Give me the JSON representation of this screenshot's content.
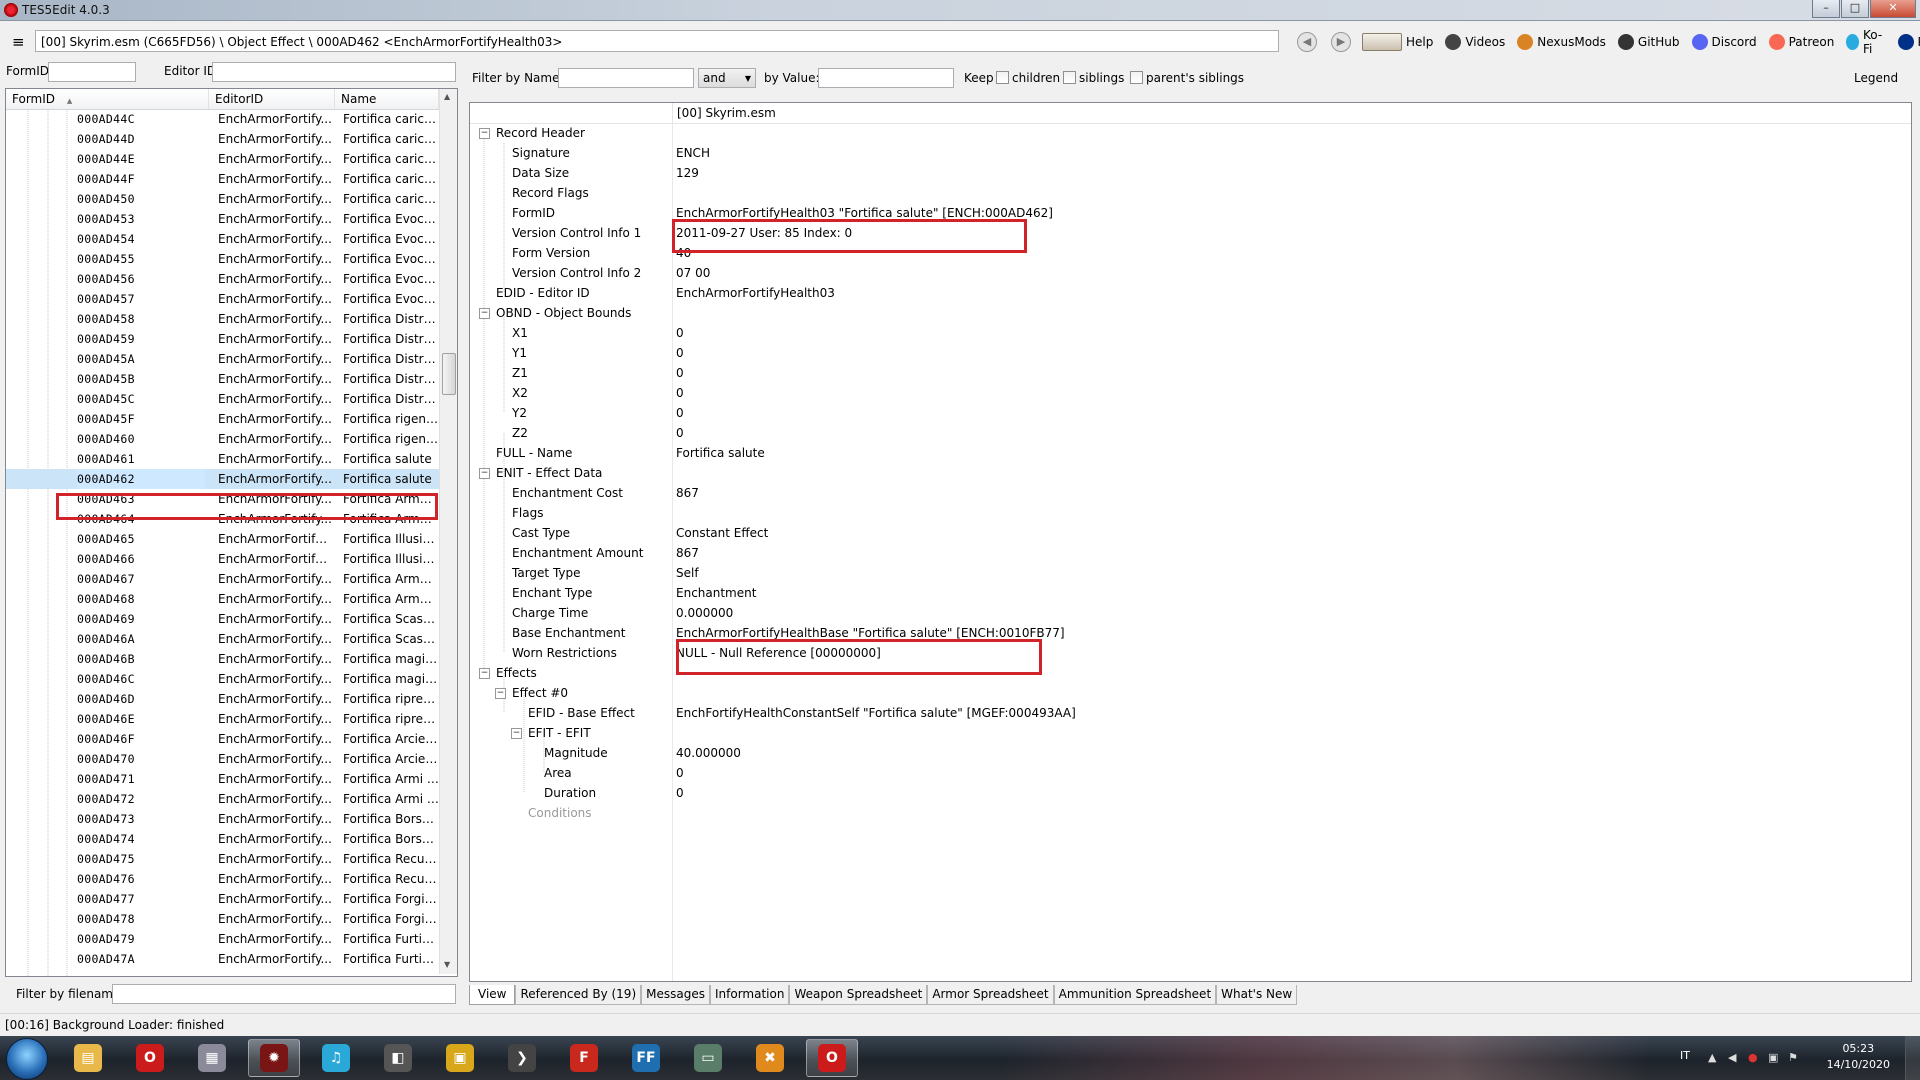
{
  "window": {
    "title": "TES5Edit 4.0.3",
    "min_label": "–",
    "max_label": "□",
    "close_label": "✕"
  },
  "pathbar": {
    "menu_glyph": "≡",
    "path": "[00] Skyrim.esm (C665FD56) \\ Object Effect \\ 000AD462 <EnchArmorFortifyHealth03>",
    "back_glyph": "◀",
    "forward_glyph": "▶",
    "links": [
      {
        "label": "Help",
        "icon": "help-book-icon",
        "color": "#8a7e68"
      },
      {
        "label": "Videos",
        "icon": "videos-icon",
        "color": "#444444"
      },
      {
        "label": "NexusMods",
        "icon": "nexusmods-icon",
        "color": "#d98324"
      },
      {
        "label": "GitHub",
        "icon": "github-icon",
        "color": "#333333"
      },
      {
        "label": "Discord",
        "icon": "discord-icon",
        "color": "#5865f2"
      },
      {
        "label": "Patreon",
        "icon": "patreon-icon",
        "color": "#f96854"
      },
      {
        "label": "Ko-Fi",
        "icon": "kofi-icon",
        "color": "#29abe0"
      },
      {
        "label": "PayPal",
        "icon": "paypal-icon",
        "color": "#003087"
      }
    ]
  },
  "left": {
    "formid_label": "FormID",
    "editorid_label": "Editor ID",
    "columns": [
      "FormID",
      "EditorID",
      "Name"
    ],
    "sort_glyph": "▲",
    "rows": [
      [
        "000AD44C",
        "EnchArmorFortify...",
        "Fortifica carico ..."
      ],
      [
        "000AD44D",
        "EnchArmorFortify...",
        "Fortifica carico ..."
      ],
      [
        "000AD44E",
        "EnchArmorFortify...",
        "Fortifica carico ..."
      ],
      [
        "000AD44F",
        "EnchArmorFortify...",
        "Fortifica carico ..."
      ],
      [
        "000AD450",
        "EnchArmorFortify...",
        "Fortifica carico ..."
      ],
      [
        "000AD453",
        "EnchArmorFortify...",
        "Fortifica Evocaz..."
      ],
      [
        "000AD454",
        "EnchArmorFortify...",
        "Fortifica Evocaz..."
      ],
      [
        "000AD455",
        "EnchArmorFortify...",
        "Fortifica Evocaz..."
      ],
      [
        "000AD456",
        "EnchArmorFortify...",
        "Fortifica Evocaz..."
      ],
      [
        "000AD457",
        "EnchArmorFortify...",
        "Fortifica Evocaz..."
      ],
      [
        "000AD458",
        "EnchArmorFortify...",
        "Fortifica Distruz..."
      ],
      [
        "000AD459",
        "EnchArmorFortify...",
        "Fortifica Distruz..."
      ],
      [
        "000AD45A",
        "EnchArmorFortify...",
        "Fortifica Distruz..."
      ],
      [
        "000AD45B",
        "EnchArmorFortify...",
        "Fortifica Distruz..."
      ],
      [
        "000AD45C",
        "EnchArmorFortify...",
        "Fortifica Distruz..."
      ],
      [
        "000AD45F",
        "EnchArmorFortify...",
        "Fortifica rigener..."
      ],
      [
        "000AD460",
        "EnchArmorFortify...",
        "Fortifica rigener..."
      ],
      [
        "000AD461",
        "EnchArmorFortify...",
        "Fortifica salute"
      ],
      [
        "000AD462",
        "EnchArmorFortify...",
        "Fortifica salute"
      ],
      [
        "000AD463",
        "EnchArmorFortify...",
        "Fortifica Armat..."
      ],
      [
        "000AD464",
        "EnchArmorFortify...",
        "Fortifica Armat..."
      ],
      [
        "000AD465",
        "EnchArmorFortifyI...",
        "Fortifica Illusione"
      ],
      [
        "000AD466",
        "EnchArmorFortifyI...",
        "Fortifica Illusione"
      ],
      [
        "000AD467",
        "EnchArmorFortify...",
        "Fortifica Armat..."
      ],
      [
        "000AD468",
        "EnchArmorFortify...",
        "Fortifica Armat..."
      ],
      [
        "000AD469",
        "EnchArmorFortify...",
        "Fortifica Scassi..."
      ],
      [
        "000AD46A",
        "EnchArmorFortify...",
        "Fortifica Scassi..."
      ],
      [
        "000AD46B",
        "EnchArmorFortify...",
        "Fortifica magicka"
      ],
      [
        "000AD46C",
        "EnchArmorFortify...",
        "Fortifica magicka"
      ],
      [
        "000AD46D",
        "EnchArmorFortify...",
        "Fortifica ripresa..."
      ],
      [
        "000AD46E",
        "EnchArmorFortify...",
        "Fortifica ripresa..."
      ],
      [
        "000AD46F",
        "EnchArmorFortify...",
        "Fortifica Arcieria"
      ],
      [
        "000AD470",
        "EnchArmorFortify...",
        "Fortifica Arcieria"
      ],
      [
        "000AD471",
        "EnchArmorFortify...",
        "Fortifica Armi a..."
      ],
      [
        "000AD472",
        "EnchArmorFortify...",
        "Fortifica Armi a..."
      ],
      [
        "000AD473",
        "EnchArmorFortify...",
        "Fortifica Borseg..."
      ],
      [
        "000AD474",
        "EnchArmorFortify...",
        "Fortifica Borseg..."
      ],
      [
        "000AD475",
        "EnchArmorFortify...",
        "Fortifica Recup..."
      ],
      [
        "000AD476",
        "EnchArmorFortify...",
        "Fortifica Recup..."
      ],
      [
        "000AD477",
        "EnchArmorFortify...",
        "Fortifica Forgiat..."
      ],
      [
        "000AD478",
        "EnchArmorFortify...",
        "Fortifica Forgiat..."
      ],
      [
        "000AD479",
        "EnchArmorFortify...",
        "Fortifica Furtività"
      ],
      [
        "000AD47A",
        "EnchArmorFortify...",
        "Fortifica Furtività"
      ]
    ],
    "selected_index": 18,
    "filter_filename_label": "Filter by filename:",
    "scroll_up": "▲",
    "scroll_down": "▼"
  },
  "right": {
    "filter_name_label": "Filter by Name:",
    "operator": "and",
    "by_value_label": "by Value:",
    "keep_label": "Keep",
    "children_label": "children",
    "siblings_label": "siblings",
    "parents_siblings_label": "parent's siblings",
    "legend_label": "Legend",
    "column_title": "[00] Skyrim.esm",
    "rows": [
      {
        "name": "Record Header",
        "value": "",
        "level": 0,
        "expander": "−"
      },
      {
        "name": "Signature",
        "value": "ENCH",
        "level": 1
      },
      {
        "name": "Data Size",
        "value": "129",
        "level": 1
      },
      {
        "name": "Record Flags",
        "value": "",
        "level": 1
      },
      {
        "name": "FormID",
        "value": "EnchArmorFortifyHealth03 \"Fortifica salute\" [ENCH:000AD462]",
        "level": 1
      },
      {
        "name": "Version Control Info 1",
        "value": "2011-09-27 User: 85 Index: 0",
        "level": 1
      },
      {
        "name": "Form Version",
        "value": "40",
        "level": 1
      },
      {
        "name": "Version Control Info 2",
        "value": "07 00",
        "level": 1
      },
      {
        "name": "EDID - Editor ID",
        "value": "EnchArmorFortifyHealth03",
        "level": 0
      },
      {
        "name": "OBND - Object Bounds",
        "value": "",
        "level": 0,
        "expander": "−"
      },
      {
        "name": "X1",
        "value": "0",
        "level": 1
      },
      {
        "name": "Y1",
        "value": "0",
        "level": 1
      },
      {
        "name": "Z1",
        "value": "0",
        "level": 1
      },
      {
        "name": "X2",
        "value": "0",
        "level": 1
      },
      {
        "name": "Y2",
        "value": "0",
        "level": 1
      },
      {
        "name": "Z2",
        "value": "0",
        "level": 1
      },
      {
        "name": "FULL - Name",
        "value": "Fortifica salute",
        "level": 0
      },
      {
        "name": "ENIT - Effect Data",
        "value": "",
        "level": 0,
        "expander": "−"
      },
      {
        "name": "Enchantment Cost",
        "value": "867",
        "level": 1
      },
      {
        "name": "Flags",
        "value": "",
        "level": 1
      },
      {
        "name": "Cast Type",
        "value": "Constant Effect",
        "level": 1
      },
      {
        "name": "Enchantment Amount",
        "value": "867",
        "level": 1
      },
      {
        "name": "Target Type",
        "value": "Self",
        "level": 1
      },
      {
        "name": "Enchant Type",
        "value": "Enchantment",
        "level": 1
      },
      {
        "name": "Charge Time",
        "value": "0.000000",
        "level": 1
      },
      {
        "name": "Base Enchantment",
        "value": "EnchArmorFortifyHealthBase \"Fortifica salute\" [ENCH:0010FB77]",
        "level": 1
      },
      {
        "name": "Worn Restrictions",
        "value": "NULL - Null Reference [00000000]",
        "level": 1
      },
      {
        "name": "Effects",
        "value": "",
        "level": 0,
        "expander": "−"
      },
      {
        "name": "Effect #0",
        "value": "",
        "level": 1,
        "expander": "−"
      },
      {
        "name": "EFID - Base Effect",
        "value": "EnchFortifyHealthConstantSelf \"Fortifica salute\" [MGEF:000493AA]",
        "level": 2
      },
      {
        "name": "EFIT - EFIT",
        "value": "",
        "level": 2,
        "expander": "−"
      },
      {
        "name": "Magnitude",
        "value": "40.000000",
        "level": 3
      },
      {
        "name": "Area",
        "value": "0",
        "level": 3
      },
      {
        "name": "Duration",
        "value": "0",
        "level": 3
      },
      {
        "name": "Conditions",
        "value": "",
        "level": 2,
        "gray": true
      }
    ],
    "tabs": [
      "View",
      "Referenced By (19)",
      "Messages",
      "Information",
      "Weapon Spreadsheet",
      "Armor Spreadsheet",
      "Ammunition Spreadsheet",
      "What's New"
    ]
  },
  "status": "[00:16] Background Loader: finished",
  "taskbar": {
    "apps": [
      {
        "name": "explorer-icon",
        "color": "#e8b84a",
        "glyph": "▤"
      },
      {
        "name": "opera-icon",
        "color": "#cc1b1b",
        "glyph": "O"
      },
      {
        "name": "calculator-icon",
        "color": "#8a8a9a",
        "glyph": "▦"
      },
      {
        "name": "tes5edit-icon",
        "color": "#7a1515",
        "glyph": "✹"
      },
      {
        "name": "music-icon",
        "color": "#2aa8d8",
        "glyph": "♫"
      },
      {
        "name": "media-icon",
        "color": "#555555",
        "glyph": "◧"
      },
      {
        "name": "folder-app-icon",
        "color": "#d8a81a",
        "glyph": "▣"
      },
      {
        "name": "arrow-app-icon",
        "color": "#444444",
        "glyph": "❯"
      },
      {
        "name": "filezilla-icon",
        "color": "#c9281c",
        "glyph": "F"
      },
      {
        "name": "ffdec-icon",
        "color": "#1f6fb0",
        "glyph": "FF"
      },
      {
        "name": "window-app-icon",
        "color": "#5a7d6a",
        "glyph": "▭"
      },
      {
        "name": "puzzle-app-icon",
        "color": "#e08a1e",
        "glyph": "✖"
      },
      {
        "name": "opera-active-icon",
        "color": "#cc1b1b",
        "glyph": "O"
      }
    ],
    "lang": "IT",
    "time": "05:23",
    "date": "14/10/2020"
  }
}
